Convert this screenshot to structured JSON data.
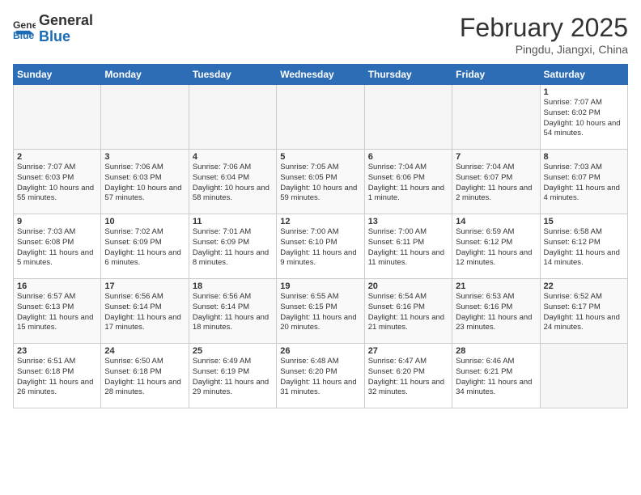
{
  "header": {
    "logo_line1": "General",
    "logo_line2": "Blue",
    "month_year": "February 2025",
    "location": "Pingdu, Jiangxi, China"
  },
  "weekdays": [
    "Sunday",
    "Monday",
    "Tuesday",
    "Wednesday",
    "Thursday",
    "Friday",
    "Saturday"
  ],
  "weeks": [
    [
      {
        "day": "",
        "info": ""
      },
      {
        "day": "",
        "info": ""
      },
      {
        "day": "",
        "info": ""
      },
      {
        "day": "",
        "info": ""
      },
      {
        "day": "",
        "info": ""
      },
      {
        "day": "",
        "info": ""
      },
      {
        "day": "1",
        "info": "Sunrise: 7:07 AM\nSunset: 6:02 PM\nDaylight: 10 hours and 54 minutes."
      }
    ],
    [
      {
        "day": "2",
        "info": "Sunrise: 7:07 AM\nSunset: 6:03 PM\nDaylight: 10 hours and 55 minutes."
      },
      {
        "day": "3",
        "info": "Sunrise: 7:06 AM\nSunset: 6:03 PM\nDaylight: 10 hours and 57 minutes."
      },
      {
        "day": "4",
        "info": "Sunrise: 7:06 AM\nSunset: 6:04 PM\nDaylight: 10 hours and 58 minutes."
      },
      {
        "day": "5",
        "info": "Sunrise: 7:05 AM\nSunset: 6:05 PM\nDaylight: 10 hours and 59 minutes."
      },
      {
        "day": "6",
        "info": "Sunrise: 7:04 AM\nSunset: 6:06 PM\nDaylight: 11 hours and 1 minute."
      },
      {
        "day": "7",
        "info": "Sunrise: 7:04 AM\nSunset: 6:07 PM\nDaylight: 11 hours and 2 minutes."
      },
      {
        "day": "8",
        "info": "Sunrise: 7:03 AM\nSunset: 6:07 PM\nDaylight: 11 hours and 4 minutes."
      }
    ],
    [
      {
        "day": "9",
        "info": "Sunrise: 7:03 AM\nSunset: 6:08 PM\nDaylight: 11 hours and 5 minutes."
      },
      {
        "day": "10",
        "info": "Sunrise: 7:02 AM\nSunset: 6:09 PM\nDaylight: 11 hours and 6 minutes."
      },
      {
        "day": "11",
        "info": "Sunrise: 7:01 AM\nSunset: 6:09 PM\nDaylight: 11 hours and 8 minutes."
      },
      {
        "day": "12",
        "info": "Sunrise: 7:00 AM\nSunset: 6:10 PM\nDaylight: 11 hours and 9 minutes."
      },
      {
        "day": "13",
        "info": "Sunrise: 7:00 AM\nSunset: 6:11 PM\nDaylight: 11 hours and 11 minutes."
      },
      {
        "day": "14",
        "info": "Sunrise: 6:59 AM\nSunset: 6:12 PM\nDaylight: 11 hours and 12 minutes."
      },
      {
        "day": "15",
        "info": "Sunrise: 6:58 AM\nSunset: 6:12 PM\nDaylight: 11 hours and 14 minutes."
      }
    ],
    [
      {
        "day": "16",
        "info": "Sunrise: 6:57 AM\nSunset: 6:13 PM\nDaylight: 11 hours and 15 minutes."
      },
      {
        "day": "17",
        "info": "Sunrise: 6:56 AM\nSunset: 6:14 PM\nDaylight: 11 hours and 17 minutes."
      },
      {
        "day": "18",
        "info": "Sunrise: 6:56 AM\nSunset: 6:14 PM\nDaylight: 11 hours and 18 minutes."
      },
      {
        "day": "19",
        "info": "Sunrise: 6:55 AM\nSunset: 6:15 PM\nDaylight: 11 hours and 20 minutes."
      },
      {
        "day": "20",
        "info": "Sunrise: 6:54 AM\nSunset: 6:16 PM\nDaylight: 11 hours and 21 minutes."
      },
      {
        "day": "21",
        "info": "Sunrise: 6:53 AM\nSunset: 6:16 PM\nDaylight: 11 hours and 23 minutes."
      },
      {
        "day": "22",
        "info": "Sunrise: 6:52 AM\nSunset: 6:17 PM\nDaylight: 11 hours and 24 minutes."
      }
    ],
    [
      {
        "day": "23",
        "info": "Sunrise: 6:51 AM\nSunset: 6:18 PM\nDaylight: 11 hours and 26 minutes."
      },
      {
        "day": "24",
        "info": "Sunrise: 6:50 AM\nSunset: 6:18 PM\nDaylight: 11 hours and 28 minutes."
      },
      {
        "day": "25",
        "info": "Sunrise: 6:49 AM\nSunset: 6:19 PM\nDaylight: 11 hours and 29 minutes."
      },
      {
        "day": "26",
        "info": "Sunrise: 6:48 AM\nSunset: 6:20 PM\nDaylight: 11 hours and 31 minutes."
      },
      {
        "day": "27",
        "info": "Sunrise: 6:47 AM\nSunset: 6:20 PM\nDaylight: 11 hours and 32 minutes."
      },
      {
        "day": "28",
        "info": "Sunrise: 6:46 AM\nSunset: 6:21 PM\nDaylight: 11 hours and 34 minutes."
      },
      {
        "day": "",
        "info": ""
      }
    ]
  ]
}
